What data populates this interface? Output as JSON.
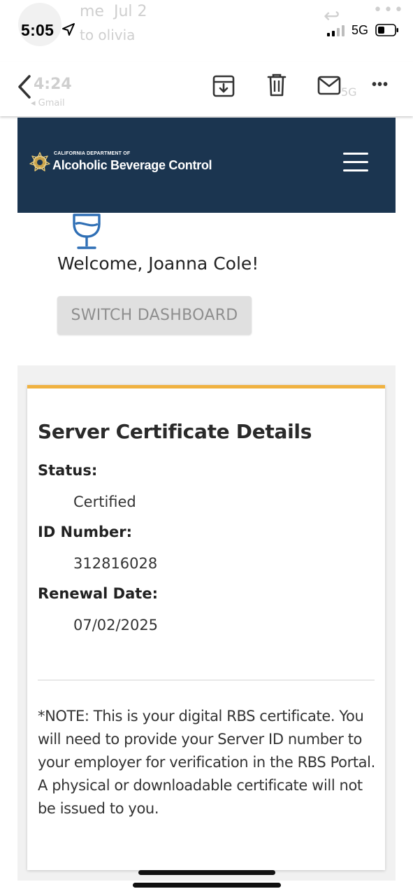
{
  "background_email": {
    "sender": "me",
    "date": "Jul 2",
    "recipient": "to olivia",
    "ghost_time": "4:24",
    "ghost_back_app": "◂ Gmail",
    "ghost_network": "5G"
  },
  "status_bar": {
    "time": "5:05",
    "network": "5G"
  },
  "toolbar": {
    "icons": [
      "chevron-left-icon",
      "archive-icon",
      "trash-icon",
      "mail-icon",
      "more-icon"
    ],
    "more_label": "•••"
  },
  "site_header": {
    "agency_line1": "CALIFORNIA DEPARTMENT OF",
    "agency_line2": "Alcoholic Beverage Control",
    "bg_color": "#1b3550"
  },
  "welcome": {
    "text": "Welcome, Joanna Cole!",
    "switch_button": "SWITCH DASHBOARD"
  },
  "certificate": {
    "title": "Server Certificate Details",
    "status_label": "Status:",
    "status_value": "Certified",
    "id_label": "ID Number:",
    "id_value": "312816028",
    "renewal_label": "Renewal Date:",
    "renewal_value": "07/02/2025",
    "accent_color": "#f0b241",
    "note": "*NOTE: This is your digital RBS certificate. You will need to provide your Server ID number to your employer for verification in the RBS Portal. A physical or downloadable certificate will not be issued to you."
  }
}
